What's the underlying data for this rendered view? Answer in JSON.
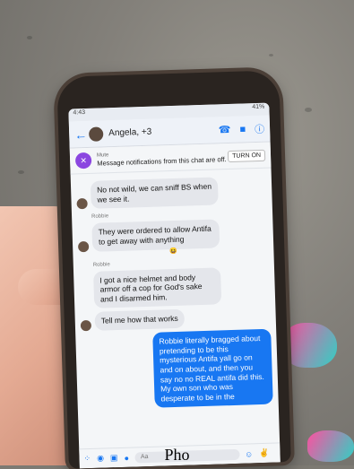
{
  "status_bar": {
    "left": "4:43",
    "right": "41%"
  },
  "header": {
    "title": "Angela, +3"
  },
  "mute_banner": {
    "title": "Mute",
    "text": "Message notifications from this chat are off.",
    "button": "TURN ON"
  },
  "messages": [
    {
      "side": "left",
      "sender": "",
      "text": "No not wild, we can sniff BS when we see it."
    },
    {
      "side": "left",
      "sender": "Robbie",
      "text": "They were ordered to allow Antifa to get away with anything"
    },
    {
      "side": "left",
      "sender": "Robbie",
      "text": "I got a nice helmet and body armor off a cop for God's sake and I disarmed him."
    },
    {
      "side": "left",
      "sender": "",
      "text": "Tell me how that works"
    },
    {
      "side": "right",
      "sender": "",
      "text": "Robbie literally bragged about pretending to be this mysterious Antifa yall go on and on about, and then you say no no REAL antifa did this. My own son who was desperate to be in the"
    }
  ],
  "composer": {
    "placeholder": "Aa"
  },
  "caption": "Pho"
}
